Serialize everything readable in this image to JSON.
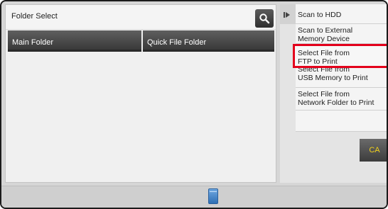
{
  "panel": {
    "title": "Folder Select",
    "search_icon": "search-icon",
    "folders": {
      "main": "Main Folder",
      "quick": "Quick File Folder"
    }
  },
  "side_menu": {
    "items": [
      {
        "lines": [
          "Scan to HDD"
        ]
      },
      {
        "lines": [
          "Scan to External",
          "Memory Device"
        ]
      },
      {
        "lines": [
          "Select File from",
          "FTP to Print"
        ],
        "highlighted": true
      },
      {
        "lines": [
          "Select File from",
          "USB Memory to Print"
        ]
      },
      {
        "lines": [
          "Select File from",
          "Network Folder to Print"
        ]
      }
    ],
    "ca_label": "CA"
  },
  "colors": {
    "highlight": "#e3001b",
    "ca_text": "#f2d21b"
  },
  "status_bar": {
    "job_status_icon": "job-status-icon"
  }
}
